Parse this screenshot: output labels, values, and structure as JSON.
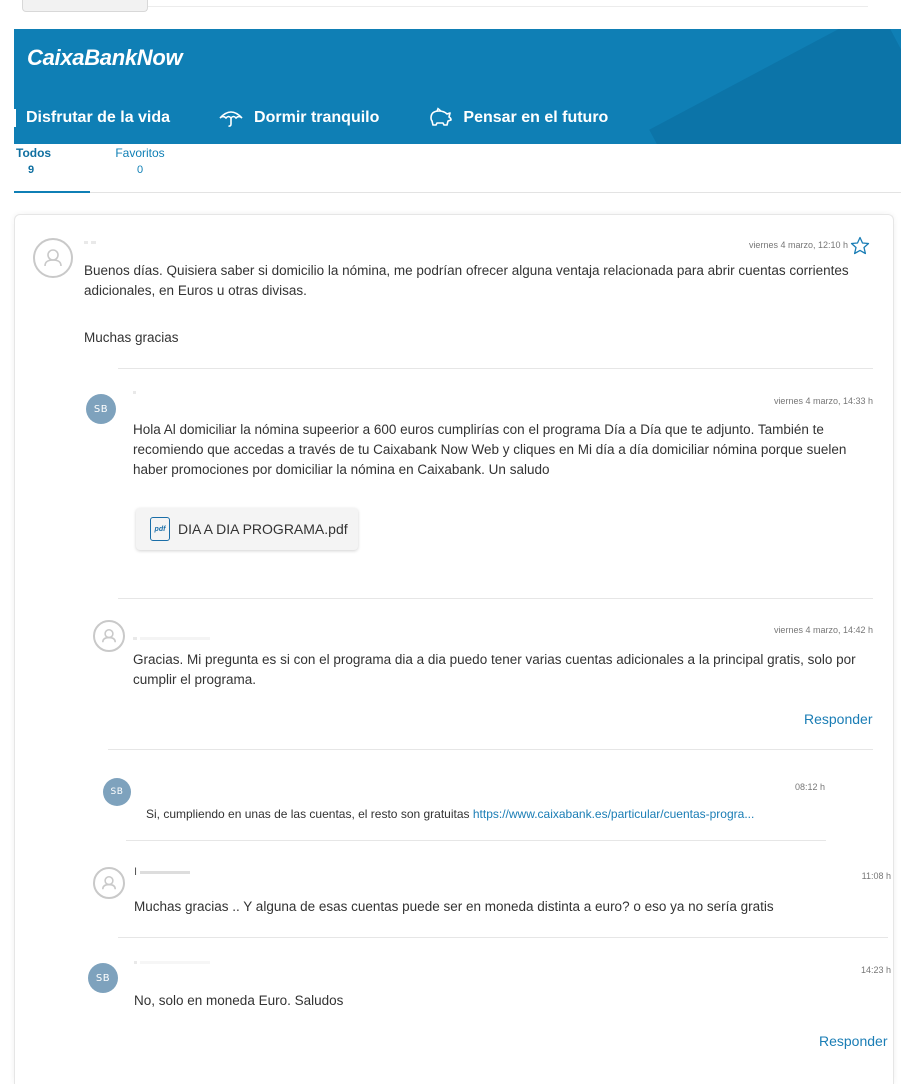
{
  "header": {
    "logo": "CaixaBankNow",
    "nav": [
      {
        "label": "Disfrutar de la vida",
        "icon": "none"
      },
      {
        "label": "Dormir tranquilo",
        "icon": "umbrella-icon"
      },
      {
        "label": "Pensar en el futuro",
        "icon": "piggy-bank-icon"
      }
    ]
  },
  "tabs": [
    {
      "label": "Todos",
      "count": "9"
    },
    {
      "label": "Favoritos",
      "count": "0"
    }
  ],
  "thread": {
    "question": {
      "author": "",
      "timestamp": "viernes 4 marzo, 12:10 h",
      "text": "Buenos días. Quisiera saber si domicilio la nómina, me podrían ofrecer alguna ventaja relacionada para abrir cuentas corrientes adicionales, en Euros u otras divisas.",
      "signoff": "Muchas gracias"
    },
    "reply1": {
      "avatar": "SB",
      "timestamp": "viernes 4 marzo, 14:33 h",
      "text": "Hola      Al domiciliar la nómina supeerior a 600 euros cumplirías con el programa Día a Día que te adjunto. También te recomiendo que accedas a través de tu Caixabank Now Web y cliques en Mi día a día domiciliar nómina porque suelen haber promociones por domiciliar la nómina en Caixabank. Un saludo",
      "attachment": "DIA A DIA PROGRAMA.pdf",
      "attachment_icon": "pdf"
    },
    "reply2": {
      "timestamp": "viernes 4 marzo, 14:42 h",
      "text": "Gracias. Mi pregunta es si con el programa dia a dia puedo tener varias cuentas adicionales a la principal gratis, solo por cumplir el programa.",
      "reply_label": "Responder"
    },
    "reply3": {
      "avatar": "SB",
      "timestamp": "08:12 h",
      "text": "Si, cumpliendo en unas de las cuentas, el resto son gratuitas ",
      "link": "https://www.caixabank.es/particular/cuentas-progra..."
    },
    "reply4": {
      "author": "I",
      "timestamp": "11:08 h",
      "text": "Muchas gracias        .. Y alguna de esas cuentas puede ser en moneda distinta a euro? o eso ya no sería gratis"
    },
    "reply5": {
      "avatar": "SB",
      "timestamp": "14:23 h",
      "text": "No, solo en moneda Euro. Saludos",
      "reply_label": "Responder"
    }
  },
  "colors": {
    "brand_blue": "#0f7fb5",
    "link_blue": "#1a7db5",
    "avatar_sb": "#7ea2bd"
  }
}
